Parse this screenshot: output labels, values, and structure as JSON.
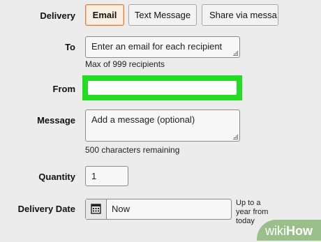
{
  "delivery": {
    "label": "Delivery",
    "options": [
      "Email",
      "Text Message",
      "Share via messa"
    ],
    "selected": "Email",
    "accent_color": "#e07b3a"
  },
  "to": {
    "label": "To",
    "value": "Enter an email for each recipient",
    "hint": "Max of 999 recipients"
  },
  "from": {
    "label": "From",
    "value": "",
    "highlight_color": "#22dd22"
  },
  "message": {
    "label": "Message",
    "value": "Add a message (optional)",
    "hint": "500 characters remaining"
  },
  "quantity": {
    "label": "Quantity",
    "value": "1"
  },
  "delivery_date": {
    "label": "Delivery Date",
    "icon": "calendar-icon",
    "value": "Now",
    "note": "Up to a year from today"
  },
  "watermark": {
    "wiki": "wiki",
    "how": "How"
  }
}
